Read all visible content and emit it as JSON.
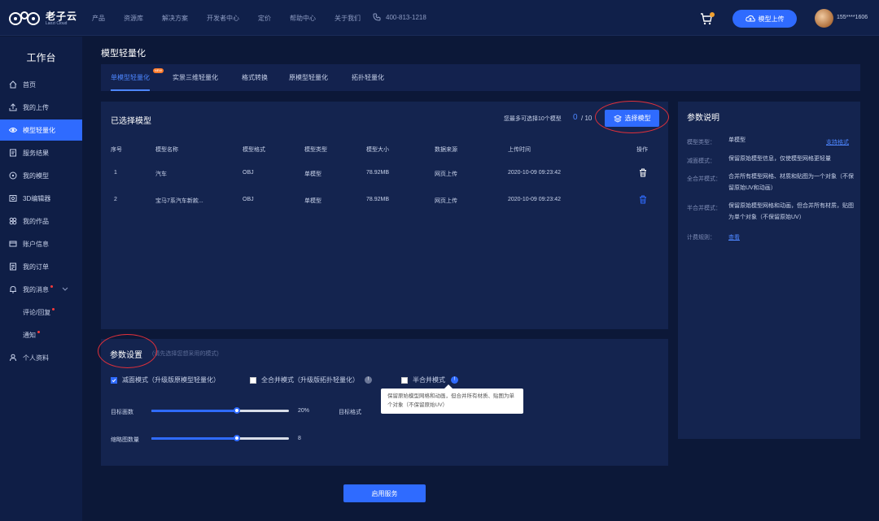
{
  "header": {
    "brand": "老子云",
    "brand_sub": "Laozi Cloud",
    "nav": [
      "产品",
      "资源库",
      "解决方案",
      "开发者中心",
      "定价",
      "帮助中心",
      "关于我们"
    ],
    "phone": "400-813-1218",
    "upload_label": "模型上传",
    "username": "155****1606"
  },
  "sidebar": {
    "title": "工作台",
    "items": [
      {
        "label": "首页",
        "icon": "home-icon"
      },
      {
        "label": "我的上传",
        "icon": "upload-icon"
      },
      {
        "label": "模型轻量化",
        "icon": "eye-icon",
        "active": true
      },
      {
        "label": "服务结果",
        "icon": "doc-icon"
      },
      {
        "label": "我的模型",
        "icon": "cube-icon"
      },
      {
        "label": "3D编辑器",
        "icon": "editor-icon"
      },
      {
        "label": "我的作品",
        "icon": "works-icon"
      },
      {
        "label": "账户信息",
        "icon": "card-icon"
      },
      {
        "label": "我的订单",
        "icon": "order-icon"
      },
      {
        "label": "我的消息",
        "icon": "bell-icon"
      },
      {
        "label": "评论/回复",
        "icon": ""
      },
      {
        "label": "通知",
        "icon": ""
      },
      {
        "label": "个人资料",
        "icon": "person-icon"
      }
    ]
  },
  "page": {
    "title": "模型轻量化",
    "tabs": [
      "单模型轻量化",
      "实景三维轻量化",
      "格式转换",
      "原模型轻量化",
      "拓扑轻量化"
    ],
    "new_badge": "NEW"
  },
  "selected": {
    "title": "已选择模型",
    "limit_text": "您最多可选择10个模型",
    "count": "0",
    "total": "/ 10",
    "select_button": "选择模型",
    "columns": [
      "序号",
      "模型名称",
      "模型格式",
      "模型类型",
      "模型大小",
      "数据来源",
      "上传时间",
      "操作"
    ],
    "rows": [
      [
        "1",
        "汽车",
        "OBJ",
        "单模型",
        "78.92MB",
        "网页上传",
        "2020-10-09 09:23:42"
      ],
      [
        "2",
        "宝马7系汽车新款...",
        "OBJ",
        "单模型",
        "78.92MB",
        "网页上传",
        "2020-10-09 09:23:42"
      ]
    ]
  },
  "params": {
    "title": "参数设置",
    "hint": "(请先选择您想采用的模式)",
    "mode1": "减面模式（升级版原模型轻量化）",
    "mode2": "全合并模式（升级版拓扑轻量化）",
    "mode3": "半合并模式",
    "tooltip": "保留原始模型网格和动画，但合并所有材质、贴图为单个对象（不保留原始UV）",
    "slider1_label": "目标面数",
    "slider1_value": "20%",
    "slider1_fraction": 0.62,
    "target_format_label": "目标格式",
    "slider2_label": "缩略图数量",
    "slider2_value": "8",
    "slider2_fraction": 0.62,
    "apply": "启用服务"
  },
  "desc": {
    "title": "参数说明",
    "rows": [
      {
        "key": "模型类型：",
        "val": "单模型"
      },
      {
        "key": "减面模式：",
        "val": "保留原始模型信息，仅使模型网格更轻量"
      },
      {
        "key": "全合并模式：",
        "val": "合并所有模型网格、材质和贴图为一个对象（不保留原始UV和动画）"
      },
      {
        "key": "半合并模式：",
        "val": "保留原始模型网格和动画，但合并所有材质，贴图为单个对象（不保留原始UV）"
      },
      {
        "key": "计费规则：",
        "val": ""
      }
    ],
    "support_link": "支持格式",
    "view_link": "查看"
  }
}
